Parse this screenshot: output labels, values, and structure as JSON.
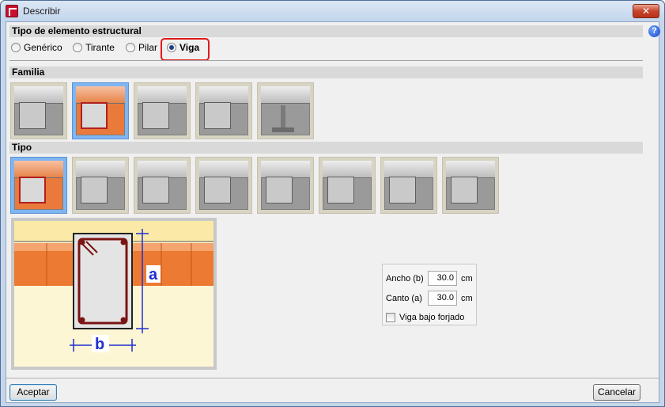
{
  "window": {
    "title": "Describir",
    "close_label": "✕",
    "help_label": "?"
  },
  "structural_type": {
    "header": "Tipo de elemento estructural",
    "options": [
      {
        "label": "Genérico",
        "checked": false
      },
      {
        "label": "Tirante",
        "checked": false
      },
      {
        "label": "Pilar",
        "checked": false
      },
      {
        "label": "Viga",
        "checked": true
      }
    ]
  },
  "familia": {
    "header": "Familia",
    "selected_index": 1,
    "items": [
      "concrete-beam-plain",
      "concrete-beam-reinforced",
      "precast-hollow-beam",
      "concrete-beam-with-plate",
      "steel-i-beam"
    ]
  },
  "tipo": {
    "header": "Tipo",
    "selected_index": 0,
    "items": [
      "rectangular-section",
      "t-section-inverted",
      "l-section",
      "t-section",
      "cross-section-large",
      "double-t-section",
      "u-section",
      "box-section"
    ]
  },
  "section_labels": {
    "height_label": "a",
    "width_label": "b"
  },
  "properties": {
    "ancho_label": "Ancho (b)",
    "ancho_value": "30.0",
    "ancho_unit": "cm",
    "canto_label": "Canto (a)",
    "canto_value": "30.0",
    "canto_unit": "cm",
    "viga_bajo_forjado_label": "Viga bajo forjado",
    "viga_bajo_forjado_checked": false
  },
  "buttons": {
    "accept": "Aceptar",
    "cancel": "Cancelar"
  },
  "colors": {
    "selected_thumb": "#7fb5f0",
    "highlight": "#e01a1a",
    "rebar": "#7a1414",
    "dimension": "#1f2fd0",
    "brick": "#e97a3c"
  }
}
